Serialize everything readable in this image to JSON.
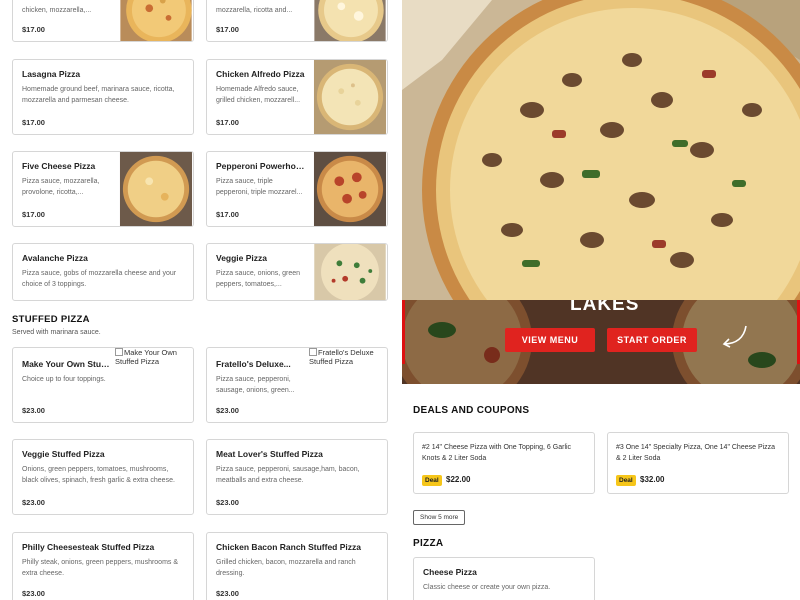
{
  "menu": {
    "top_cards": [
      {
        "desc": "chicken, mozzarella,...",
        "price": "$17.00"
      },
      {
        "desc": "mozzarella, ricotta and...",
        "price": "$17.00"
      }
    ],
    "pizza_cards": [
      {
        "name": "Lasagna Pizza",
        "desc": "Homemade ground beef, marinara sauce, ricotta, mozzarella and parmesan cheese.",
        "price": "$17.00"
      },
      {
        "name": "Chicken Alfredo Pizza",
        "desc": "Homemade Alfredo sauce, grilled chicken, mozzarell...",
        "price": "$17.00"
      },
      {
        "name": "Five Cheese Pizza",
        "desc": "Pizza sauce, mozzarella, provolone, ricotta,...",
        "price": "$17.00"
      },
      {
        "name": "Pepperoni Powerhous...",
        "desc": "Pizza sauce, triple pepperoni, triple mozzarel...",
        "price": "$17.00"
      },
      {
        "name": "Avalanche Pizza",
        "desc": "Pizza sauce, gobs of mozzarella cheese and your choice of 3 toppings.",
        "price": ""
      },
      {
        "name": "Veggie Pizza",
        "desc": "Pizza sauce, onions, green peppers, tomatoes,...",
        "price": ""
      }
    ],
    "stuffed": {
      "title": "STUFFED PIZZA",
      "subtitle": "Served with marinara sauce.",
      "cards": [
        {
          "name": "Make Your Own Stuffe...",
          "desc": "Choice up to four toppings.",
          "price": "$23.00",
          "img_alt": "Make Your Own Stuffed Pizza"
        },
        {
          "name": "Fratello's Deluxe...",
          "desc": "Pizza sauce, pepperoni, sausage, onions, green...",
          "price": "$23.00",
          "img_alt": "Fratello's Deluxe Stuffed Pizza"
        },
        {
          "name": "Veggie Stuffed Pizza",
          "desc": "Onions, green peppers, tomatoes, mushrooms, black olives, spinach, fresh garlic & extra cheese.",
          "price": "$23.00"
        },
        {
          "name": "Meat Lover's Stuffed Pizza",
          "desc": "Pizza sauce, pepperoni, sausage,ham, bacon, meatballs and extra cheese.",
          "price": "$23.00"
        },
        {
          "name": "Philly Cheesesteak Stuffed Pizza",
          "desc": "Philly steak, onions, green peppers, mushrooms & extra cheese.",
          "price": "$23.00"
        },
        {
          "name": "Chicken Bacon Ranch Stuffed Pizza",
          "desc": "Grilled chicken, bacon, mozzarella and ranch dressing.",
          "price": "$23.00"
        }
      ]
    }
  },
  "banner": {
    "heading": "LAKES",
    "view_menu": "VIEW MENU",
    "start_order": "START ORDER"
  },
  "deals": {
    "title": "DEALS AND COUPONS",
    "items": [
      {
        "text": "#2 14\" Cheese Pizza with One Topping, 6 Garlic Knots & 2 Liter Soda",
        "tag": "Deal",
        "price": "$22.00"
      },
      {
        "text": "#3 One 14\" Specialty Pizza, One 14\" Cheese Pizza & 2 Liter Soda",
        "tag": "Deal",
        "price": "$32.00"
      }
    ],
    "show_more": "Show 5 more"
  },
  "pizza_section": {
    "title": "PIZZA",
    "first_card": {
      "name": "Cheese Pizza",
      "desc": "Classic cheese or create your own pizza."
    }
  },
  "colors": {
    "accent_red": "#e0231f",
    "deal_yellow": "#f6c61a"
  }
}
